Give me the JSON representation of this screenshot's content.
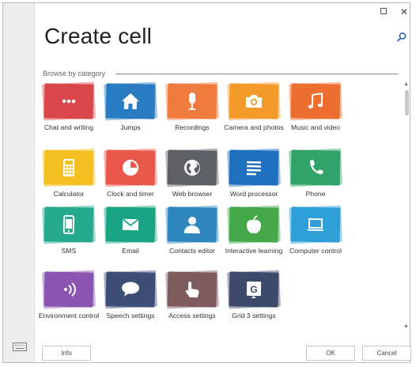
{
  "dialog": {
    "title": "Create cell",
    "category_label": "Browse by category",
    "window_controls": {
      "maximize": "",
      "close": "✕"
    }
  },
  "tiles": [
    {
      "label": "Chat and writing",
      "color": "#d9474a",
      "icon": "chat-icon"
    },
    {
      "label": "Jumps",
      "color": "#2a7cc2",
      "icon": "home-icon"
    },
    {
      "label": "Recordings",
      "color": "#f07b3f",
      "icon": "microphone-icon"
    },
    {
      "label": "Camera and photos",
      "color": "#f39a2b",
      "icon": "camera-icon"
    },
    {
      "label": "Music and video",
      "color": "#ec6f2f",
      "icon": "music-note-icon"
    },
    {
      "label": "Calculator",
      "color": "#f4c021",
      "icon": "calculator-icon"
    },
    {
      "label": "Clock and timer",
      "color": "#e9584b",
      "icon": "clock-icon"
    },
    {
      "label": "Web browser",
      "color": "#5f6065",
      "icon": "globe-icon"
    },
    {
      "label": "Word processor",
      "color": "#1f6fbf",
      "icon": "document-icon"
    },
    {
      "label": "Phone",
      "color": "#2fa36a",
      "icon": "phone-icon"
    },
    {
      "label": "SMS",
      "color": "#27a98c",
      "icon": "mobile-icon"
    },
    {
      "label": "Email",
      "color": "#19a584",
      "icon": "envelope-icon"
    },
    {
      "label": "Contacts editor",
      "color": "#2d86bd",
      "icon": "person-icon"
    },
    {
      "label": "Interactive learning",
      "color": "#45a84a",
      "icon": "apple-icon"
    },
    {
      "label": "Computer control",
      "color": "#2f9fd8",
      "icon": "laptop-icon"
    },
    {
      "label": "Environment control",
      "color": "#8a55b0",
      "icon": "wireless-icon"
    },
    {
      "label": "Speech settings",
      "color": "#3d4f77",
      "icon": "speech-bubble-icon"
    },
    {
      "label": "Access settings",
      "color": "#7d5b5f",
      "icon": "pointer-hand-icon"
    },
    {
      "label": "Grid 3 settings",
      "color": "#3e4a6a",
      "icon": "grid3-logo-icon"
    }
  ],
  "buttons": {
    "info": "Info",
    "ok": "OK",
    "cancel": "Cancel"
  }
}
